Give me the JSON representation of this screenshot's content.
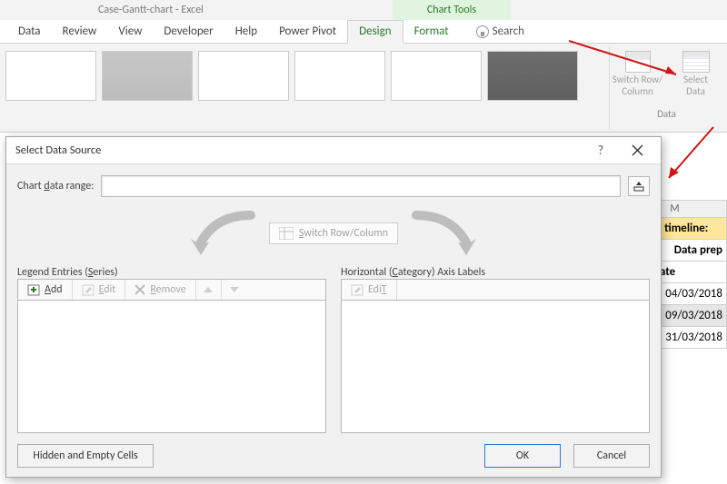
{
  "app": {
    "title": "Case-Gantt-chart  -  Excel",
    "chart_tools_label": "Chart Tools"
  },
  "tabs": {
    "data": "Data",
    "review": "Review",
    "view": "View",
    "developer": "Developer",
    "help": "Help",
    "power_pivot": "Power Pivot",
    "design": "Design",
    "format": "Format",
    "search": "Search"
  },
  "ribbon": {
    "switch_row_column": "Switch Row/\nColumn",
    "select_data": "Select\nData",
    "data_group": "Data"
  },
  "sheet": {
    "col_letter": "M",
    "project_title": "Project timeline:",
    "data_prep": "Data prep",
    "start_date_header": "Start date",
    "rows": [
      "04/03/2018",
      "09/03/2018",
      "31/03/2018"
    ]
  },
  "dialog": {
    "title": "Select Data Source",
    "range_label_pre": "Chart ",
    "range_label_u": "d",
    "range_label_post": "ata range:",
    "range_value": "",
    "switch_row_column": "Switch Row/Column",
    "legend_pre": "Legend Entries (",
    "legend_u": "S",
    "legend_post": "eries)",
    "category_pre": "Horizontal (",
    "category_u": "C",
    "category_post": "ategory) Axis Labels",
    "btn_add_u": "A",
    "btn_add": "dd",
    "btn_edit_l_u": "E",
    "btn_edit_l": "dit",
    "btn_remove_u": "R",
    "btn_remove": "emove",
    "btn_edit_r_u": "T",
    "btn_edit_r_pre": "Edi",
    "btn_hidden_u": "H",
    "btn_hidden": "idden and Empty Cells",
    "btn_ok": "OK",
    "btn_cancel": "Cancel"
  }
}
